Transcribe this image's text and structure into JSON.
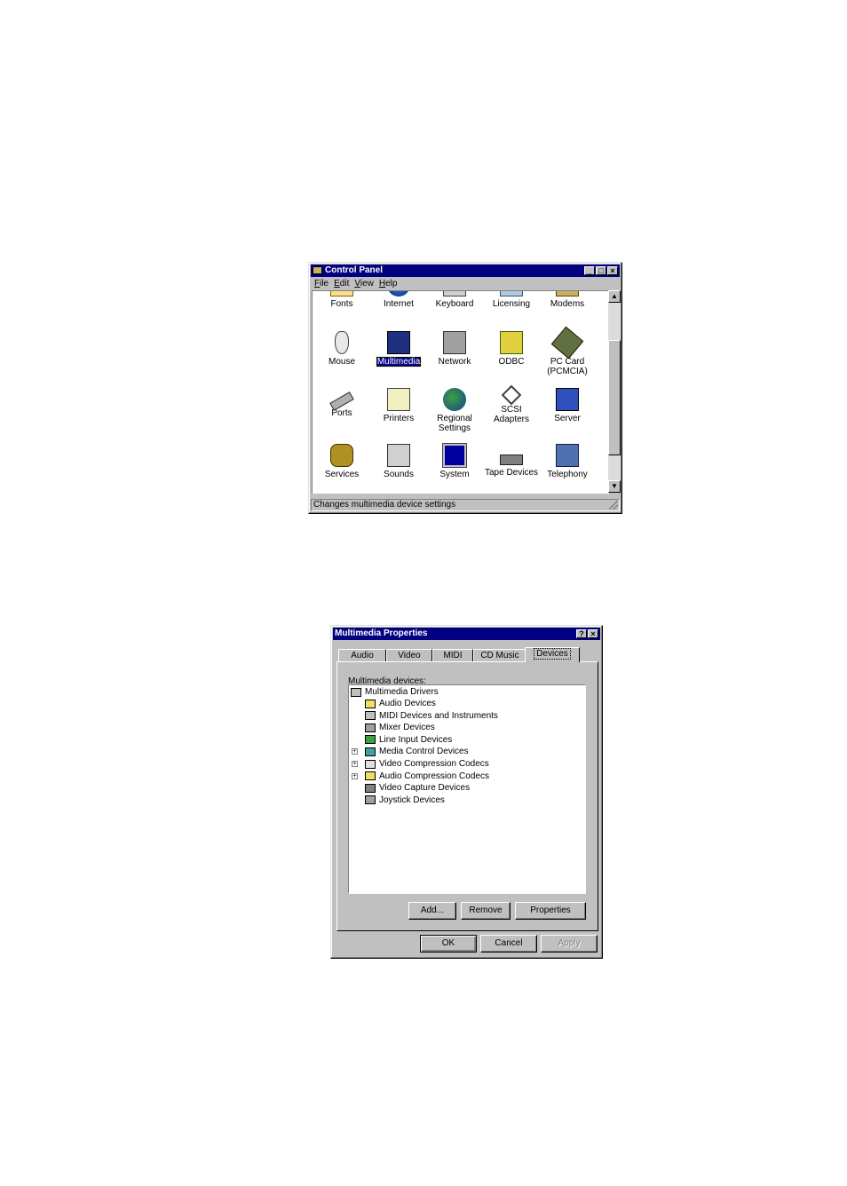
{
  "control_panel": {
    "title": "Control Panel",
    "menu": [
      "File",
      "Edit",
      "View",
      "Help"
    ],
    "items": [
      {
        "label": "Fonts",
        "icon": "fonts-icon"
      },
      {
        "label": "Internet",
        "icon": "internet-icon"
      },
      {
        "label": "Keyboard",
        "icon": "keyboard-icon"
      },
      {
        "label": "Licensing",
        "icon": "licensing-icon"
      },
      {
        "label": "Modems",
        "icon": "modems-icon"
      },
      {
        "label": "Mouse",
        "icon": "mouse-icon"
      },
      {
        "label": "Multimedia",
        "icon": "multimedia-icon",
        "selected": true
      },
      {
        "label": "Network",
        "icon": "network-icon"
      },
      {
        "label": "ODBC",
        "icon": "odbc-icon"
      },
      {
        "label": "PC Card (PCMCIA)",
        "icon": "pc-card-icon"
      },
      {
        "label": "Ports",
        "icon": "ports-icon"
      },
      {
        "label": "Printers",
        "icon": "printers-icon"
      },
      {
        "label": "Regional Settings",
        "icon": "regional-settings-icon"
      },
      {
        "label": "SCSI Adapters",
        "icon": "scsi-adapters-icon"
      },
      {
        "label": "Server",
        "icon": "server-icon"
      },
      {
        "label": "Services",
        "icon": "services-icon"
      },
      {
        "label": "Sounds",
        "icon": "sounds-icon"
      },
      {
        "label": "System",
        "icon": "system-icon"
      },
      {
        "label": "Tape Devices",
        "icon": "tape-devices-icon"
      },
      {
        "label": "Telephony",
        "icon": "telephony-icon"
      }
    ],
    "status": "Changes multimedia device settings"
  },
  "multimedia": {
    "title": "Multimedia Properties",
    "tabs": [
      "Audio",
      "Video",
      "MIDI",
      "CD Music",
      "Devices"
    ],
    "active_tab": "Devices",
    "devices_label": "Multimedia devices:",
    "tree_root": "Multimedia Drivers",
    "tree_items": [
      {
        "label": "Audio Devices",
        "expandable": false
      },
      {
        "label": "MIDI Devices and Instruments",
        "expandable": false
      },
      {
        "label": "Mixer Devices",
        "expandable": false
      },
      {
        "label": "Line Input Devices",
        "expandable": false
      },
      {
        "label": "Media Control Devices",
        "expandable": true
      },
      {
        "label": "Video Compression Codecs",
        "expandable": true
      },
      {
        "label": "Audio Compression Codecs",
        "expandable": true
      },
      {
        "label": "Video Capture Devices",
        "expandable": false
      },
      {
        "label": "Joystick Devices",
        "expandable": false
      }
    ],
    "buttons": {
      "add": "Add...",
      "remove": "Remove",
      "properties": "Properties"
    },
    "footer": {
      "ok": "OK",
      "cancel": "Cancel",
      "apply": "Apply"
    }
  }
}
